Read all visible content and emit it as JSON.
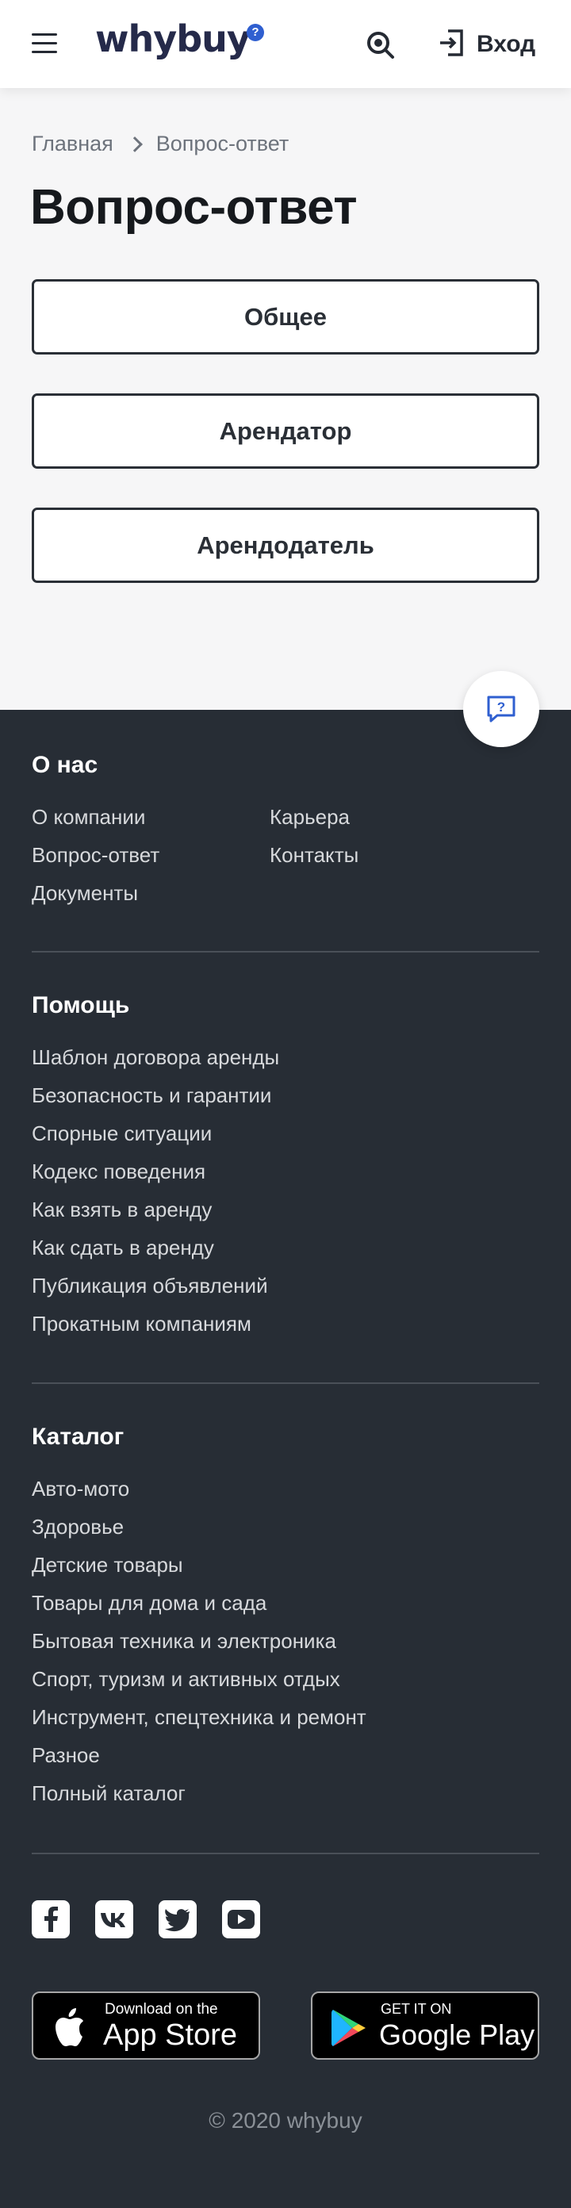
{
  "header": {
    "logo": "whybuy",
    "logo_badge": "?",
    "login_label": "Вход"
  },
  "breadcrumb": {
    "home": "Главная",
    "current": "Вопрос-ответ"
  },
  "page_title": "Вопрос-ответ",
  "categories": [
    "Общее",
    "Арендатор",
    "Арендодатель"
  ],
  "footer": {
    "about": {
      "title": "О нас",
      "links_left": [
        "О компании",
        "Вопрос-ответ",
        "Документы"
      ],
      "links_right": [
        "Карьера",
        "Контакты"
      ]
    },
    "help": {
      "title": "Помощь",
      "links": [
        "Шаблон договора аренды",
        "Безопасность и гарантии",
        "Спорные ситуации",
        "Кодекс поведения",
        "Как взять в аренду",
        "Как сдать в аренду",
        "Публикация объявлений",
        "Прокатным компаниям"
      ]
    },
    "catalog": {
      "title": "Каталог",
      "links": [
        "Авто-мото",
        "Здоровье",
        "Детские товары",
        "Товары для дома и сада",
        "Бытовая техника и электроника",
        "Спорт, туризм и активных отдых",
        "Инструмент, спецтехника и ремонт",
        "Разное",
        "Полный каталог"
      ]
    },
    "social_icons": [
      "facebook-icon",
      "vk-icon",
      "twitter-icon",
      "youtube-icon"
    ],
    "app_store": {
      "small": "Download on the",
      "big": "App Store"
    },
    "google_play": {
      "small": "GET IT ON",
      "big": "Google Play"
    },
    "copyright": "© 2020 whybuy"
  },
  "colors": {
    "accent": "#2f5fd0",
    "footer_bg": "#272d35",
    "page_bg": "#f6f6f7"
  }
}
